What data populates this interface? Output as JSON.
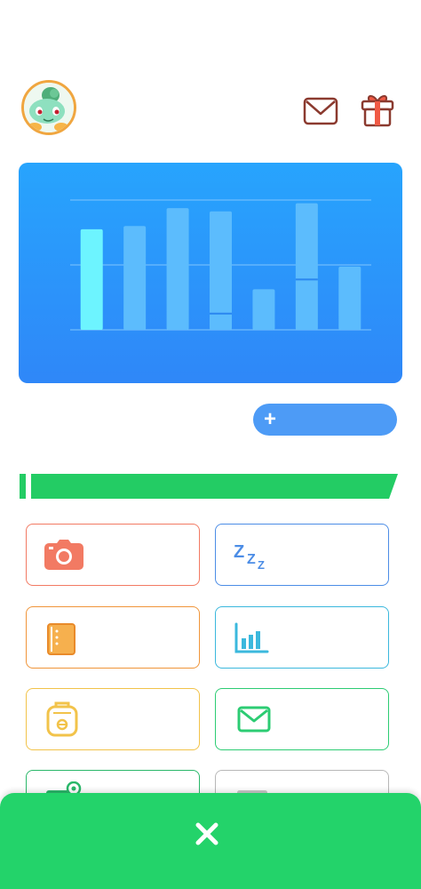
{
  "header": {
    "avatar": "bulbasaur-avatar",
    "icons": [
      "mail-icon",
      "gift-icon"
    ]
  },
  "chart_data": {
    "type": "bar",
    "categories": [
      "",
      "",
      "",
      "",
      "",
      "",
      ""
    ],
    "series": [
      {
        "values": [
          62,
          64,
          75,
          73,
          25,
          78,
          39
        ]
      },
      {
        "values": [
          0,
          0,
          0,
          10,
          0,
          31,
          0
        ]
      }
    ],
    "ylim": [
      0,
      80
    ],
    "grid": true,
    "highlight_index": 0,
    "colors": {
      "bar": "#5cbcfd",
      "bar_highlight": "#6df4ff",
      "grid": "#7fc5fd",
      "background": "#2a96fa"
    }
  },
  "actions": {
    "add_button_icon": "plus-icon",
    "add_button_symbol": "+"
  },
  "section": {
    "banner_color": "#23cc64"
  },
  "tiles": [
    {
      "icon": "camera-icon",
      "color": "#f27a63"
    },
    {
      "icon": "sleep-zzz-icon",
      "color": "#4c8de6"
    },
    {
      "icon": "notebook-icon",
      "color": "#f0953a"
    },
    {
      "icon": "bar-chart-icon",
      "color": "#3bb8dd"
    },
    {
      "icon": "backpack-icon",
      "color": "#f2c34a"
    },
    {
      "icon": "mail-icon",
      "color": "#2ccc73"
    },
    {
      "icon": "pokeball-icon",
      "color": "#2ab86a"
    },
    {
      "icon": "unknown-icon",
      "color": "#b8b8b8"
    }
  ],
  "bottom_sheet": {
    "close_icon": "close-icon",
    "color": "#23d36a"
  }
}
